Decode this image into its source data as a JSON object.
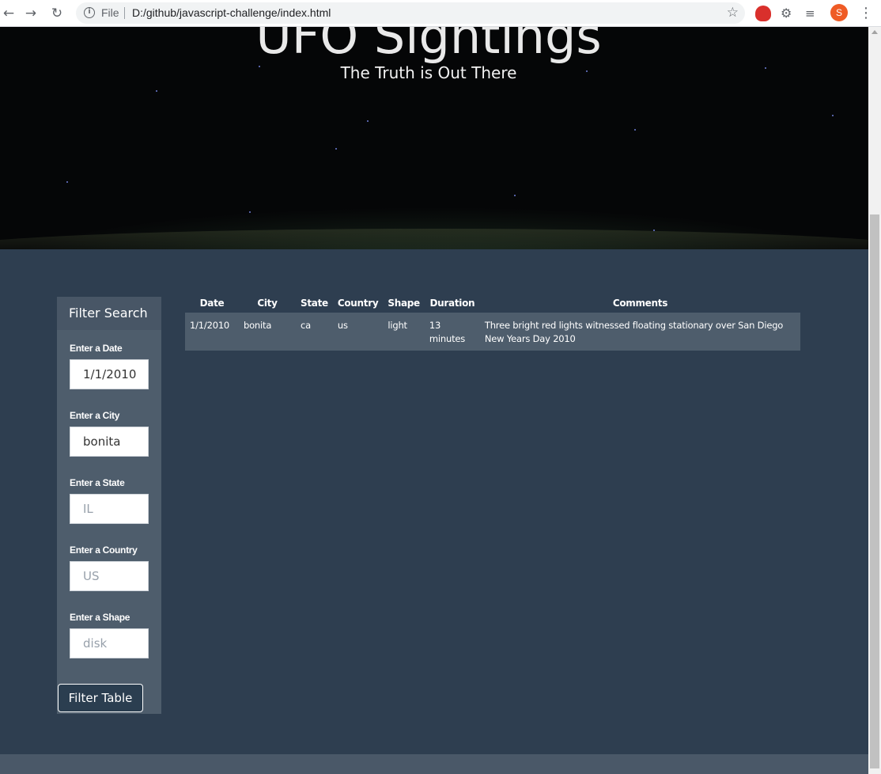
{
  "browser": {
    "file_label": "File",
    "url": "D:/github/javascript-challenge/index.html",
    "avatar_letter": "S",
    "icons": [
      "back-arrow-icon",
      "forward-arrow-icon",
      "reload-icon",
      "info-icon",
      "star-icon",
      "ublock-icon",
      "puzzle-icon",
      "playlist-icon",
      "menu-dots-icon"
    ]
  },
  "hero": {
    "title": "UFO Sightings",
    "subtitle": "The Truth is Out There"
  },
  "filters": {
    "heading": "Filter Search",
    "date": {
      "label": "Enter a Date",
      "value": "1/1/2010",
      "placeholder": "1/1/2010"
    },
    "city": {
      "label": "Enter a City",
      "value": "bonita",
      "placeholder": ""
    },
    "state": {
      "label": "Enter a State",
      "value": "",
      "placeholder": "IL"
    },
    "country": {
      "label": "Enter a Country",
      "value": "",
      "placeholder": "US"
    },
    "shape": {
      "label": "Enter a Shape",
      "value": "",
      "placeholder": "disk"
    },
    "button_label": "Filter Table"
  },
  "table": {
    "headers": [
      "Date",
      "City",
      "State",
      "Country",
      "Shape",
      "Duration",
      "Comments"
    ],
    "rows": [
      [
        "1/1/2010",
        "bonita",
        "ca",
        "us",
        "light",
        "13 minutes",
        "Three bright red lights witnessed floating stationary over San Diego New Years Day 2010"
      ]
    ]
  },
  "colors": {
    "page_bg": "#2e3e50",
    "panel_bg": "#4e5d6c",
    "accent_button_border": "#ffffff"
  }
}
